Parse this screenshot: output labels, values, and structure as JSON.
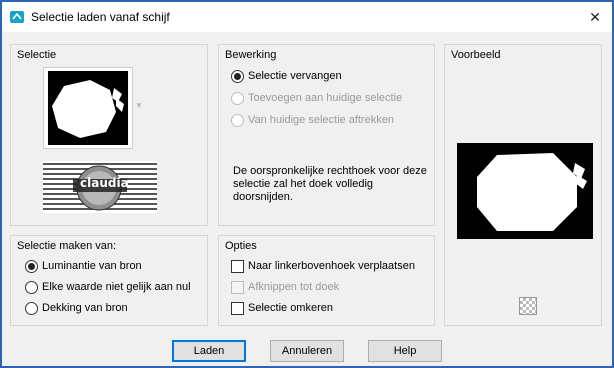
{
  "window": {
    "title": "Selectie laden vanaf schijf",
    "close_glyph": "✕"
  },
  "groups": {
    "selectie": {
      "title": "Selectie"
    },
    "bewerking": {
      "title": "Bewerking",
      "options": [
        {
          "label": "Selectie vervangen",
          "checked": true,
          "enabled": true
        },
        {
          "label": "Toevoegen aan huidige selectie",
          "checked": false,
          "enabled": false
        },
        {
          "label": "Van huidige selectie aftrekken",
          "checked": false,
          "enabled": false
        }
      ],
      "description": "De oorspronkelijke rechthoek voor deze selectie zal het doek volledig doorsnijden."
    },
    "voorbeeld": {
      "title": "Voorbeeld"
    },
    "selectie_maken": {
      "title": "Selectie maken van:",
      "options": [
        {
          "label": "Luminantie van bron",
          "checked": true
        },
        {
          "label": "Elke waarde niet gelijk aan nul",
          "checked": false
        },
        {
          "label": "Dekking van bron",
          "checked": false
        }
      ]
    },
    "opties": {
      "title": "Opties",
      "checks": [
        {
          "label": "Naar linkerbovenhoek verplaatsen",
          "checked": false,
          "enabled": true
        },
        {
          "label": "Afknippen tot doek",
          "checked": false,
          "enabled": false
        },
        {
          "label": "Selectie omkeren",
          "checked": false,
          "enabled": true
        }
      ]
    }
  },
  "watermark_text": "claudia",
  "buttons": {
    "load": "Laden",
    "cancel": "Annuleren",
    "help": "Help"
  },
  "colors": {
    "window_border": "#2f63b6",
    "title_icon": "#1aa3c8",
    "default_button_border": "#0078d7"
  },
  "icons": {
    "title": "load-selection-icon",
    "dropdown": "chevron-down-icon",
    "zoom": "checker-zoom-icon"
  }
}
